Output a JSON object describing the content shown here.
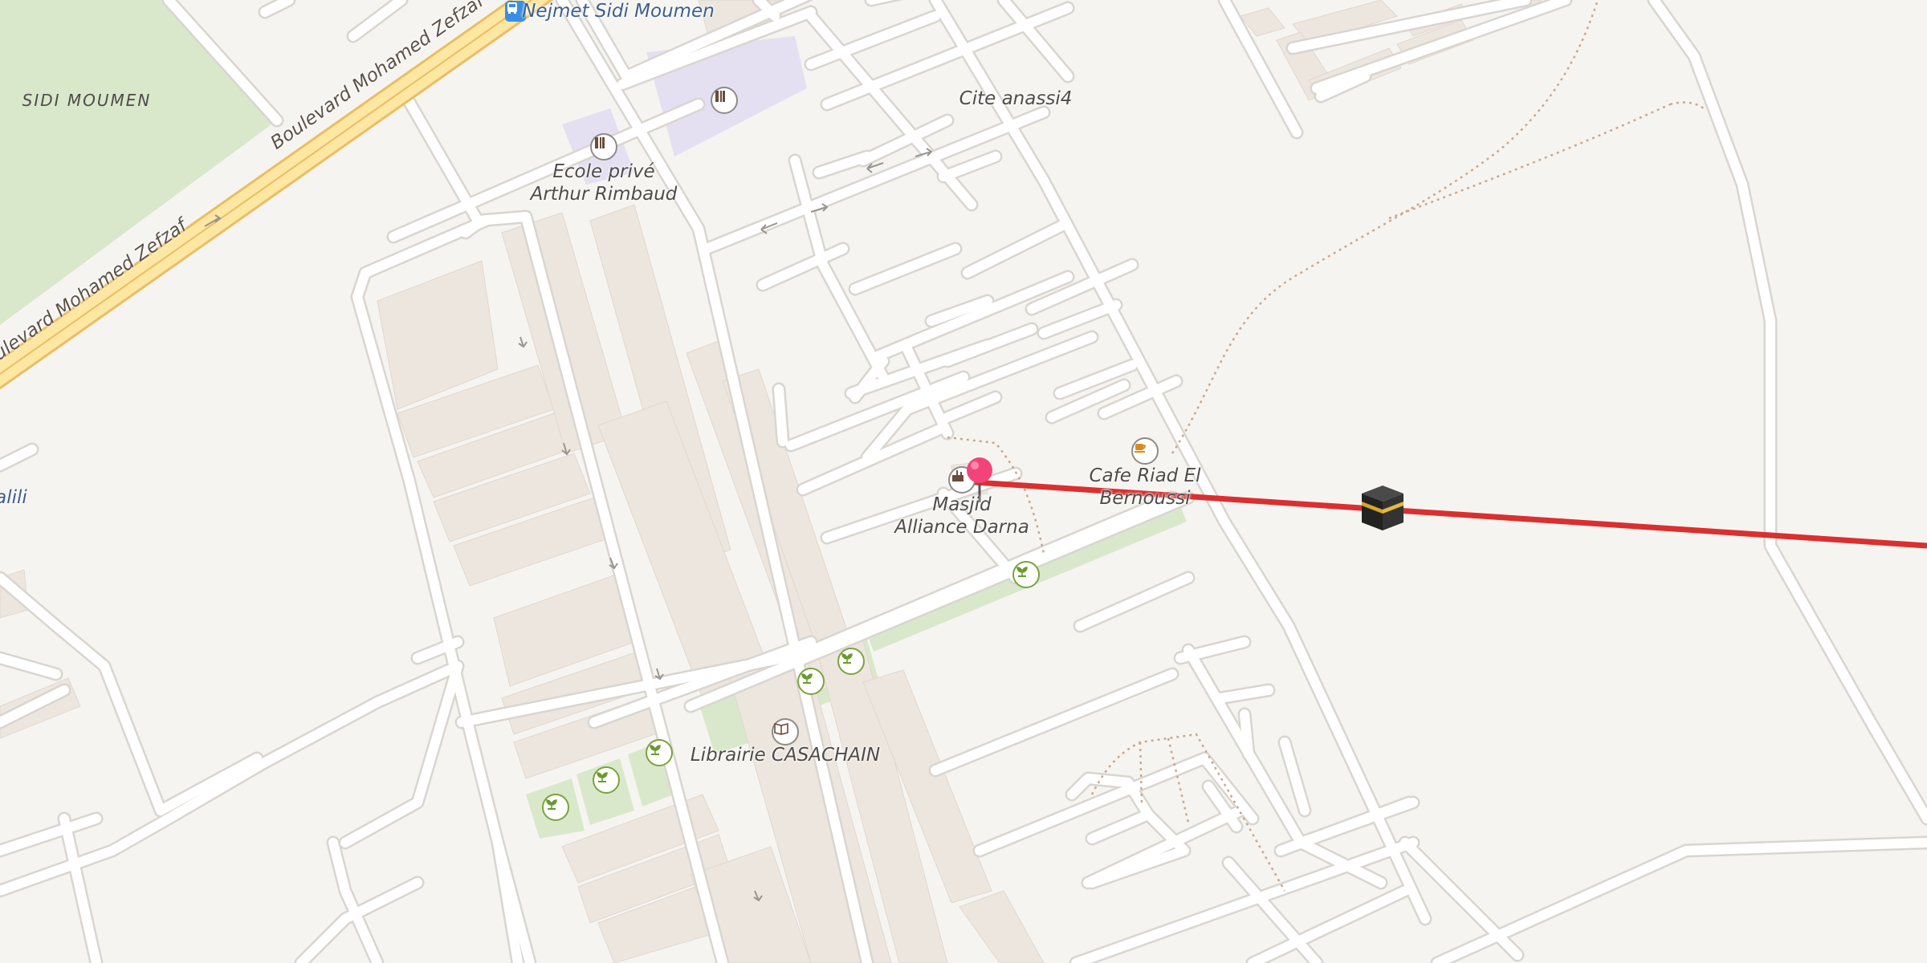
{
  "map": {
    "labels": {
      "district": "SIDI MOUMEN",
      "bus_stop": "Nejmet Sidi Moumen",
      "road_upper": "Boulevard Mohamed Zefzaf",
      "road_lower": "Boulevard Mohamed Zefzaf",
      "cite": "Cite anassi4",
      "school": "Ecole privé Arthur Rimbaud",
      "mosque": "Masjid Alliance Darna",
      "cafe": "Cafe Riad El Bernoussi",
      "bookshop": "Librairie CASACHAIN",
      "edge_left": "alili"
    },
    "icons": {
      "bus": "bus-stop-icon",
      "school": "school-icon",
      "mosque": "mosque-icon",
      "cafe": "cafe-icon",
      "bookshop": "book-icon",
      "garden": "garden-icon",
      "pin": "location-pin-icon",
      "kaaba": "kaaba-icon"
    },
    "colors": {
      "background": "#f6f4f1",
      "road_fill": "#ffffff",
      "road_casing": "#d9d5d0",
      "major_road": "#fde7a2",
      "major_road_casing": "#e9be64",
      "park": "#d9e8cb",
      "building": "#ede6df",
      "qibla_line": "#d9302f",
      "pin": "#f2447b",
      "label": "#4f4c49",
      "bus_label": "#3d5f8c"
    }
  }
}
